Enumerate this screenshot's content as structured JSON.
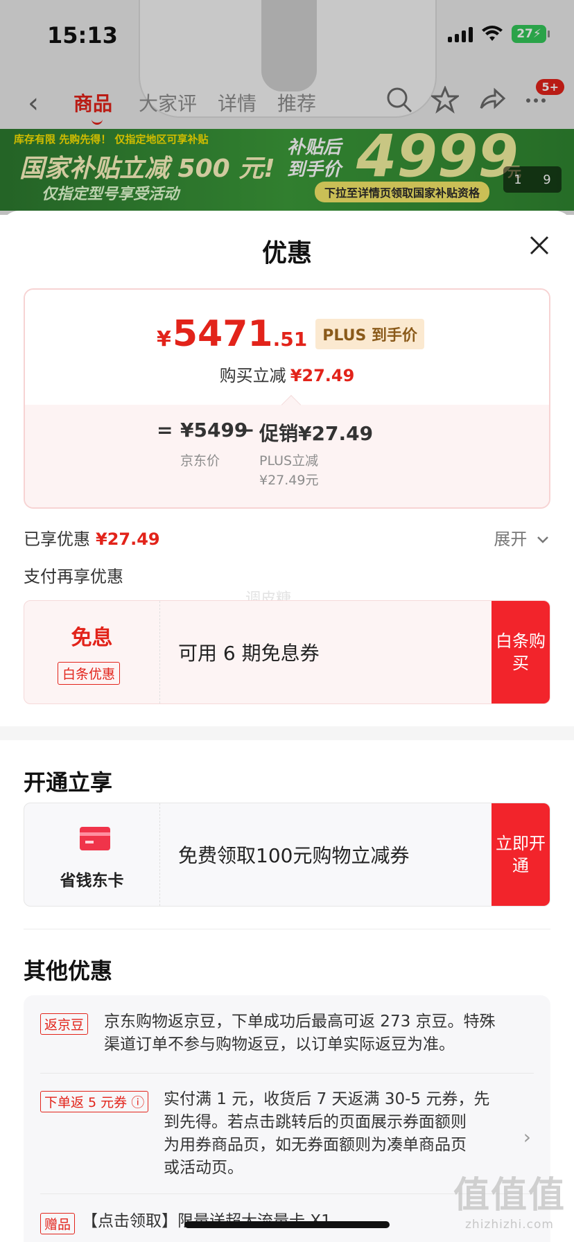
{
  "status_bar": {
    "time": "15:13",
    "battery": "27"
  },
  "nav": {
    "back_icon": "chevron-left-icon",
    "tabs": [
      {
        "label": "商品",
        "active": true
      },
      {
        "label": "大家评",
        "active": false
      },
      {
        "label": "详情",
        "active": false
      },
      {
        "label": "推荐",
        "active": false
      }
    ],
    "badge": "5+"
  },
  "banner": {
    "top_line": "库存有限 先购先得！ 仅指定地区可享补贴",
    "main": "国家补贴立减 500 元!",
    "sub": "仅指定型号享受活动",
    "right_l1": "补贴后",
    "right_l2": "到手价",
    "price": "4999",
    "unit": "元",
    "note": "下拉至详情页领取国家补贴资格",
    "pager_current": "1",
    "pager_total": "9"
  },
  "sheet": {
    "title": "优惠",
    "price": {
      "yen": "¥",
      "integer": "5471",
      "decimal": ".51",
      "plus_tag": "PLUS 到手价",
      "instant_label": "购买立减",
      "instant_amount": "¥27.49"
    },
    "breakdown": {
      "equals": "=",
      "base_amount": "¥5499",
      "base_label": "京东价",
      "minus": "−",
      "promo_amount": "促销¥27.49",
      "promo_label": "PLUS立减",
      "promo_sub": "¥27.49元"
    },
    "enjoyed_label": "已享优惠",
    "enjoyed_amount": "¥27.49",
    "expand_label": "展开",
    "pay_extra_label": "支付再享优惠",
    "watermark": "调皮糖",
    "baitiao": {
      "title": "免息",
      "tag": "白条优惠",
      "desc": "可用 6 期免息券",
      "button": "白条购买"
    },
    "open_section_title": "开通立享",
    "savings_card": {
      "label": "省钱东卡",
      "desc": "免费领取100元购物立减券",
      "button": "立即开通"
    },
    "other_section_title": "其他优惠",
    "other_items": [
      {
        "tag": "返京豆",
        "text_l1": "京东购物返京豆，下单成功后最高可返 273 京豆。特殊",
        "text_l2": "渠道订单不参与购物返豆，以订单实际返豆为准。"
      },
      {
        "tag": "下单返 5 元券 ⓘ",
        "text_l1": "实付满 1 元，收货后 7 天返满 30-5 元券，先",
        "text_l2": "到先得。若点击跳转后的页面展示券面额则",
        "text_l3": "为用券商品页，如无券面额则为凑单商品页",
        "text_l4": "或活动页。"
      },
      {
        "tag": "赠品",
        "text_l1": "【点击领取】限量送超大流量卡 X1"
      }
    ]
  },
  "site_watermark": {
    "big": "值值值",
    "small": "zhizhizhi.com"
  },
  "colors": {
    "brand_red": "#e2231a",
    "button_red": "#f2242b",
    "banner_green": "#3c9b3a"
  }
}
